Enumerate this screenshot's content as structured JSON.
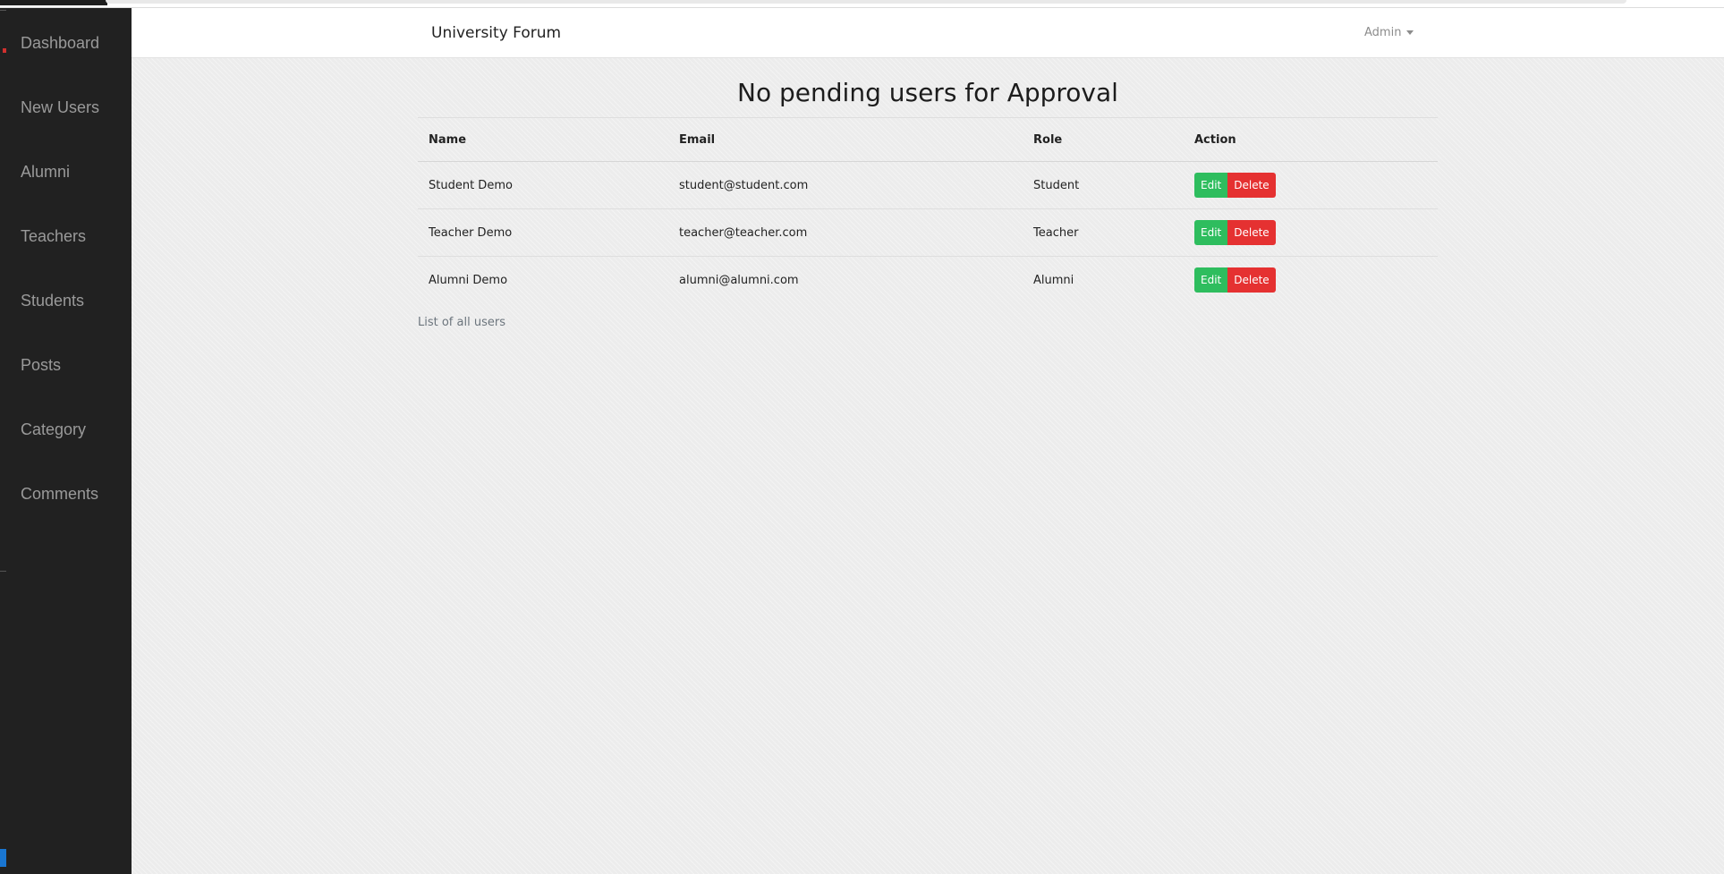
{
  "sidebar": {
    "items": [
      {
        "label": "Dashboard"
      },
      {
        "label": "New Users"
      },
      {
        "label": "Alumni"
      },
      {
        "label": "Teachers"
      },
      {
        "label": "Students"
      },
      {
        "label": "Posts"
      },
      {
        "label": "Category"
      },
      {
        "label": "Comments"
      }
    ]
  },
  "navbar": {
    "brand": "University Forum",
    "user_menu": "Admin"
  },
  "main": {
    "heading": "No pending users for Approval",
    "table": {
      "columns": [
        "Name",
        "Email",
        "Role",
        "Action"
      ],
      "rows": [
        {
          "name": "Student Demo",
          "email": "student@student.com",
          "role": "Student"
        },
        {
          "name": "Teacher Demo",
          "email": "teacher@teacher.com",
          "role": "Teacher"
        },
        {
          "name": "Alumni Demo",
          "email": "alumni@alumni.com",
          "role": "Alumni"
        }
      ],
      "actions": {
        "edit": "Edit",
        "delete": "Delete"
      },
      "caption": "List of all users"
    }
  },
  "colors": {
    "sidebar_bg": "#212121",
    "edit_button": "#2ebd5e",
    "delete_button": "#e53131"
  }
}
